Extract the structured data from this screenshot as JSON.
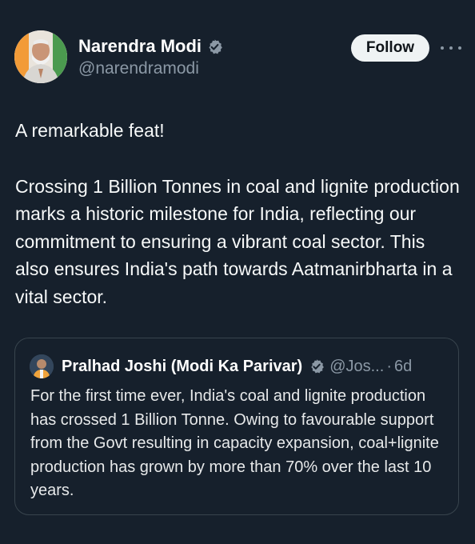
{
  "author": {
    "display_name": "Narendra Modi",
    "handle": "@narendramodi",
    "avatar_icon": "profile-photo"
  },
  "actions": {
    "follow_label": "Follow",
    "more_icon": "ellipsis-icon"
  },
  "tweet": {
    "paragraph_1": "A remarkable feat!",
    "paragraph_2": "Crossing 1 Billion Tonnes in coal and lignite production marks a historic milestone for India, reflecting our commitment to ensuring a vibrant coal sector. This also ensures India's path towards Aatmanirbharta in a vital sector."
  },
  "quoted_tweet": {
    "display_name": "Pralhad Joshi (Modi Ka Parivar)",
    "handle": "@Jos...",
    "separator": "·",
    "time": "6d",
    "text": "For the first time ever, India's coal and lignite production has crossed 1 Billion Tonne. Owing to favourable support from the Govt resulting in capacity expansion, coal+lignite production has grown by more than 70% over the last 10 years."
  },
  "colors": {
    "background": "#16202c",
    "verified_blue": "#1d9bf0",
    "secondary_text": "#8b98a5",
    "border": "#38444d"
  }
}
